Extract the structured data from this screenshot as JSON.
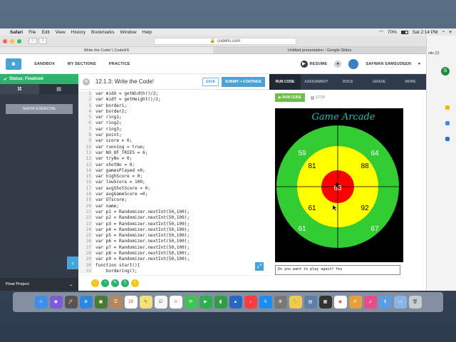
{
  "menubar": {
    "app": "Safari",
    "items": [
      "File",
      "Edit",
      "View",
      "History",
      "Bookmarks",
      "Window",
      "Help"
    ],
    "battery": "70%",
    "clock": "Sat 2:14 PM"
  },
  "browser": {
    "url": "codehs.com",
    "tabs": [
      "Write the Code! | CodeHS",
      "Untitled presentation - Google Slides"
    ]
  },
  "nav": {
    "links": [
      "SANDBOX",
      "MY SECTIONS",
      "PRACTICE"
    ],
    "resume": "RESUME",
    "user": "SAFWAN SAMSUDEEN"
  },
  "sidebar": {
    "status": "Status: Finalized",
    "show_exercise": "SHOW EXERCISE",
    "final_project": "Final Project"
  },
  "editor": {
    "title": "12.1.3: Write the Code!",
    "save": "SAVE",
    "submit": "SUBMIT + CONTINUE",
    "lines": [
      "var midX = getWidth()/2;",
      "var midY = getHeight()/2;",
      "var border1;",
      "var border2;",
      "var ring1;",
      "var ring2;",
      "var ring3;",
      "var point;",
      "var score = 0;",
      "var running = true;",
      "var NO_OF_TRIES = 6;",
      "var tryNo = 0;",
      "var shotNo = 0;",
      "var gamesPlayed =0;",
      "var highScore = 0;",
      "var lowScore = 100;",
      "var avgShotScore = 0;",
      "var avgGameScore =0;",
      "var OTscore;",
      "var name;",
      "var p1 = Randomizer.nextInt(50,100);",
      "var p2 = Randomizer.nextInt(50,100);",
      "var p3 = Randomizer.nextInt(50,100);",
      "var p4 = Randomizer.nextInt(50,100);",
      "var p5 = Randomizer.nextInt(50,100);",
      "var p6 = Randomizer.nextInt(50,100);",
      "var p7 = Randomizer.nextInt(50,100);",
      "var p8 = Randomizer.nextInt(50,100);",
      "var p9 = Randomizer.nextInt(50,100);",
      "function start(){",
      "    bordering();"
    ]
  },
  "run": {
    "tabs": [
      "RUN CODE",
      "ASSIGNMENT",
      "DOCS",
      "GRADE",
      "MORE"
    ],
    "run_label": "RUN CODE",
    "stop_label": "STOP",
    "canvas": {
      "title": "Game Arcade",
      "green_scores": [
        "59",
        "64",
        "61",
        "67"
      ],
      "yellow_scores": [
        "81",
        "88",
        "61",
        "92"
      ],
      "center_score": "63",
      "colors": {
        "background": "#000000",
        "outer": "#33cc33",
        "middle": "#ffff00",
        "inner": "#ff0000",
        "title": "#19c0b0"
      }
    },
    "console": "Do you want to play again? Yes"
  },
  "right_window": {
    "profile_label": "nito (2)",
    "avatar": "S"
  }
}
